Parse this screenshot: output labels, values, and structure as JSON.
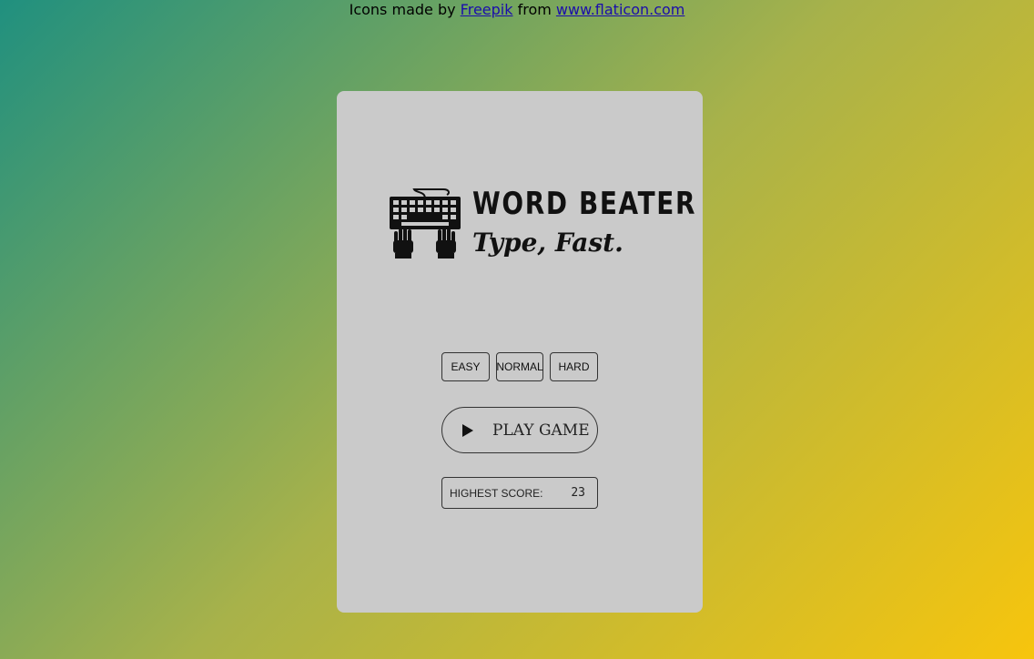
{
  "attribution": {
    "prefix": "Icons made by",
    "author": "Freepik",
    "middle": "from",
    "site": "www.flaticon.com"
  },
  "logo": {
    "icon": "keyboard-hands-icon",
    "title": "WORD BEATER",
    "tagline": "Type, Fast."
  },
  "difficulty": {
    "options": [
      "EASY",
      "NORMAL",
      "HARD"
    ]
  },
  "play": {
    "icon": "play-icon",
    "label": "PLAY GAME"
  },
  "score": {
    "label": "HIGHEST SCORE:",
    "value": "23"
  },
  "colors": {
    "card": "#cacaca",
    "gradient_start": "#20907f",
    "gradient_end": "#f7c50d"
  }
}
